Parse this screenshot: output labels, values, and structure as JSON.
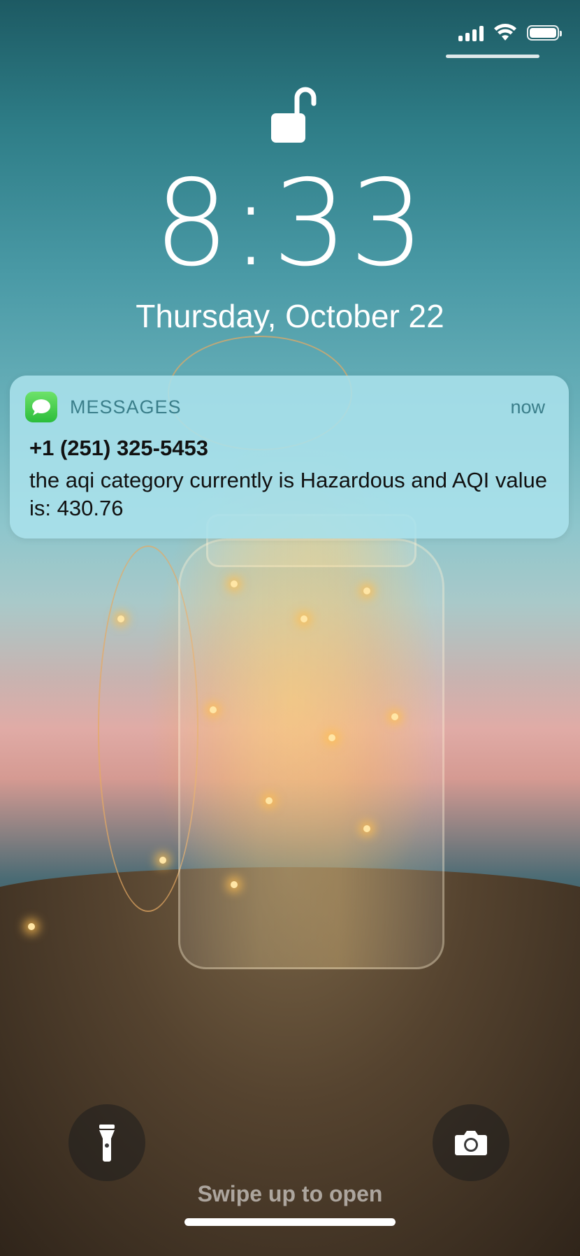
{
  "status_bar": {
    "signal_bars": 4,
    "wifi_icon": "wifi-icon",
    "battery_level": 1.0
  },
  "lock": {
    "icon": "unlocked-padlock-icon"
  },
  "clock": {
    "time": "8:33",
    "date": "Thursday, October 22"
  },
  "notification": {
    "app_icon": "messages-app-icon",
    "app_name": "MESSAGES",
    "timestamp": "now",
    "sender": "+1 (251) 325-5453",
    "body": "the aqi category currently is Hazardous and AQI value is: 430.76"
  },
  "quick_actions": {
    "left_icon": "flashlight-icon",
    "right_icon": "camera-icon"
  },
  "footer": {
    "hint": "Swipe up to open"
  },
  "colors": {
    "notification_bg": "#aae1ec",
    "app_label": "#3a7e8a",
    "messages_green": "#34c759"
  }
}
